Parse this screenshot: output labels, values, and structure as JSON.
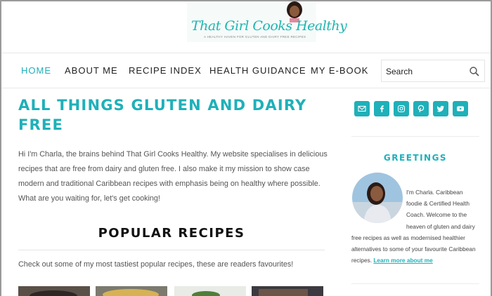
{
  "logo": {
    "name": "That Girl Cooks Healthy",
    "tagline": "A HEALTHY HAVEN FOR GLUTEN AND DAIRY FREE RECIPES"
  },
  "nav": {
    "items": [
      {
        "label": "HOME",
        "active": true
      },
      {
        "label": "ABOUT ME"
      },
      {
        "label": "RECIPE INDEX"
      },
      {
        "label": "HEALTH GUIDANCE"
      },
      {
        "label": "MY E-BOOK"
      }
    ]
  },
  "search": {
    "placeholder": "Search",
    "icon": "search-icon"
  },
  "main": {
    "title": "ALL THINGS GLUTEN AND DAIRY FREE",
    "intro": "Hi I'm Charla, the brains behind That Girl Cooks Healthy. My website specialises in delicious recipes that are free from dairy and gluten free. I also make it my mission to show case modern and traditional Caribbean recipes with emphasis being on healthy where possible. What are you waiting for, let's get cooking!",
    "popular_title": "POPULAR RECIPES",
    "popular_sub": "Check out some of my most tastiest popular recipes, these are readers favourites!"
  },
  "sidebar": {
    "social_icons": [
      "email-icon",
      "facebook-icon",
      "instagram-icon",
      "pinterest-icon",
      "twitter-icon",
      "youtube-icon"
    ],
    "greetings_title": "GREETINGS",
    "bio_text": "I'm Charla. Caribbean foodie & Certified Health Coach. Welcome to the heaven of gluten and dairy free recipes as well as modernised healthier alternatives to some of your favourite Caribbean recipes. ",
    "bio_link": "Learn more about me"
  },
  "colors": {
    "accent": "#1fb0b9",
    "text": "#555555"
  }
}
